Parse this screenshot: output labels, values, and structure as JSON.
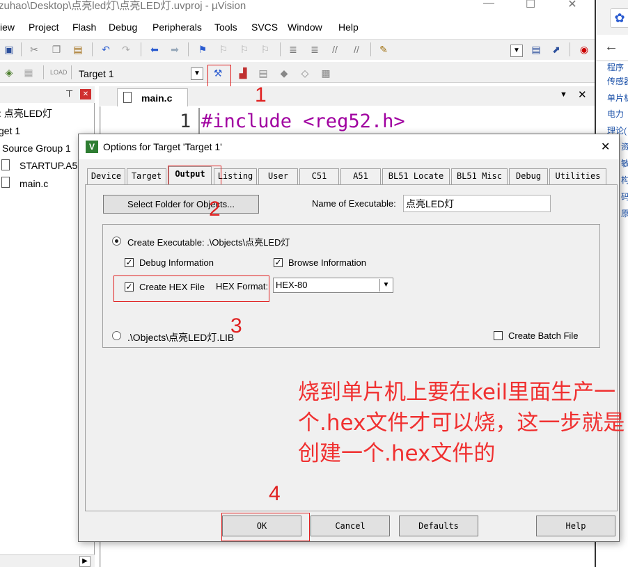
{
  "window": {
    "title": "zuhao\\Desktop\\点亮led灯\\点亮LED灯.uvproj - µVision"
  },
  "menu": [
    "iew",
    "Project",
    "Flash",
    "Debug",
    "Peripherals",
    "Tools",
    "SVCS",
    "Window",
    "Help"
  ],
  "toolbar2": {
    "target_select": "Target 1"
  },
  "project_pane": {
    "items": [
      ": 点亮LED灯",
      "get 1",
      "Source Group 1",
      "STARTUP.A51",
      "main.c"
    ]
  },
  "editor": {
    "tab_label": "main.c",
    "line_number": "1",
    "line_text": "#include <reg52.h>"
  },
  "browser": {
    "links": [
      "程序",
      "传感器",
      "单片机",
      "电力",
      "理论(",
      "资",
      "敏",
      "构",
      "码",
      "原"
    ]
  },
  "dialog": {
    "title": "Options for Target 'Target 1'",
    "tabs": [
      "Device",
      "Target",
      "Output",
      "Listing",
      "User",
      "C51",
      "A51",
      "BL51 Locate",
      "BL51 Misc",
      "Debug",
      "Utilities"
    ],
    "active_tab": "Output",
    "select_folder_label": "Select Folder for Objects...",
    "name_of_exe_label": "Name of Executable:",
    "name_of_exe_value": "点亮LED灯",
    "create_exe_label": "Create Executable:  .\\Objects\\点亮LED灯",
    "debug_info_label": "Debug Information",
    "browse_info_label": "Browse Information",
    "create_hex_label": "Create HEX File",
    "hex_format_label": "HEX Format:",
    "hex_format_value": "HEX-80",
    "create_lib_label": ".\\Objects\\点亮LED灯.LIB",
    "create_batch_label": "Create Batch File",
    "ok_label": "OK",
    "cancel_label": "Cancel",
    "defaults_label": "Defaults",
    "help_label": "Help",
    "debug_info_checked": true,
    "browse_info_checked": true,
    "create_hex_checked": true,
    "create_batch_checked": false
  },
  "annotations": {
    "n1": "1",
    "n2": "2",
    "n3": "3",
    "n4": "4",
    "note": "烧到单片机上要在keil里面生产一个.hex文件才可以烧，这一步就是创建一个.hex文件的"
  },
  "colors": {
    "annotation_red": "#e02020"
  }
}
